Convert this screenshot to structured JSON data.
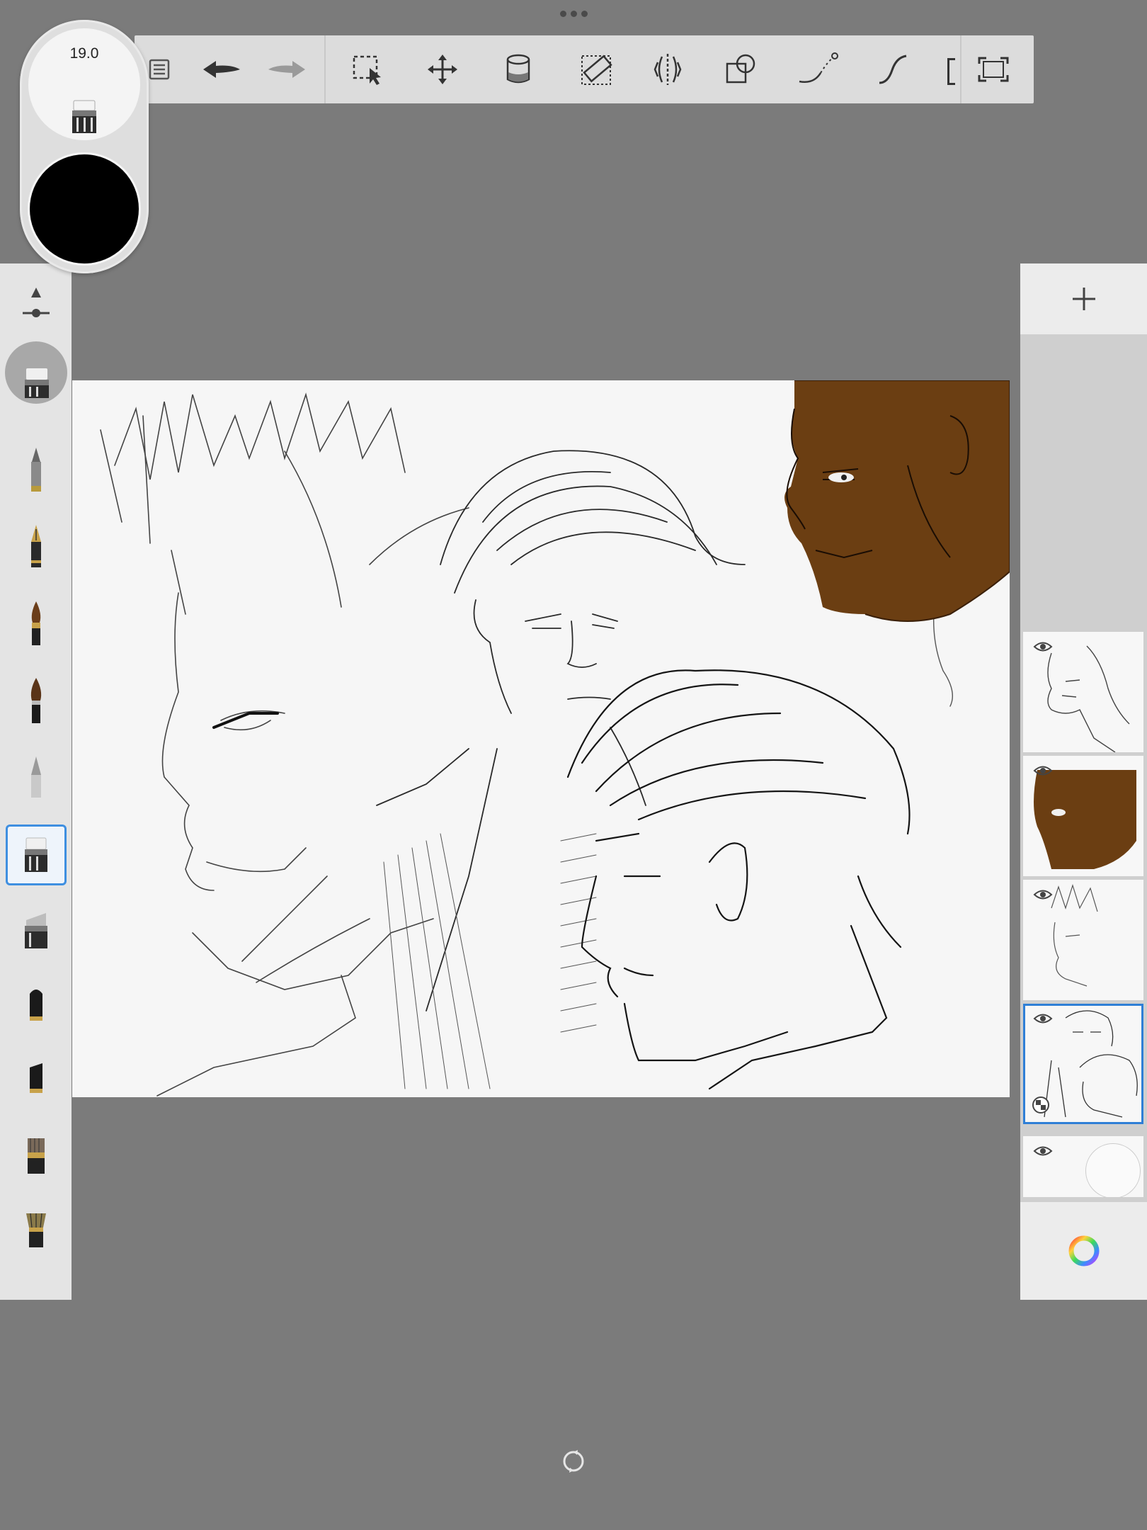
{
  "app": {
    "brush_size": "19.0",
    "current_color": "#000000"
  },
  "toolbar": {
    "tools": [
      "list-icon",
      "undo-icon",
      "redo-icon",
      "selection-icon",
      "transform-icon",
      "fill-icon",
      "ruler-icon",
      "symmetry-icon",
      "shape-icon",
      "curve-icon",
      "steady-stroke-icon",
      "fullscreen-icon"
    ]
  },
  "brushes": {
    "selected_index": 6,
    "items": [
      "ballpoint-pen",
      "fountain-pen",
      "brush",
      "ink-brush",
      "pencil",
      "airbrush-eraser",
      "marker",
      "felt-pen",
      "chisel-marker",
      "flat-brush",
      "fan-brush"
    ]
  },
  "layers": {
    "count": 5,
    "selected_index": 3,
    "items": [
      {
        "name": "layer-sketch-dark-man-lines",
        "visible": true
      },
      {
        "name": "layer-brown-skin-fill",
        "visible": true
      },
      {
        "name": "layer-spiky-hair-man",
        "visible": true
      },
      {
        "name": "layer-two-men-sketch",
        "visible": true
      },
      {
        "name": "layer-background-paper",
        "visible": true
      }
    ]
  },
  "colors": {
    "accent": "#2f7fd6",
    "skin": "#6b3e12",
    "background": "#7b7b7b"
  }
}
